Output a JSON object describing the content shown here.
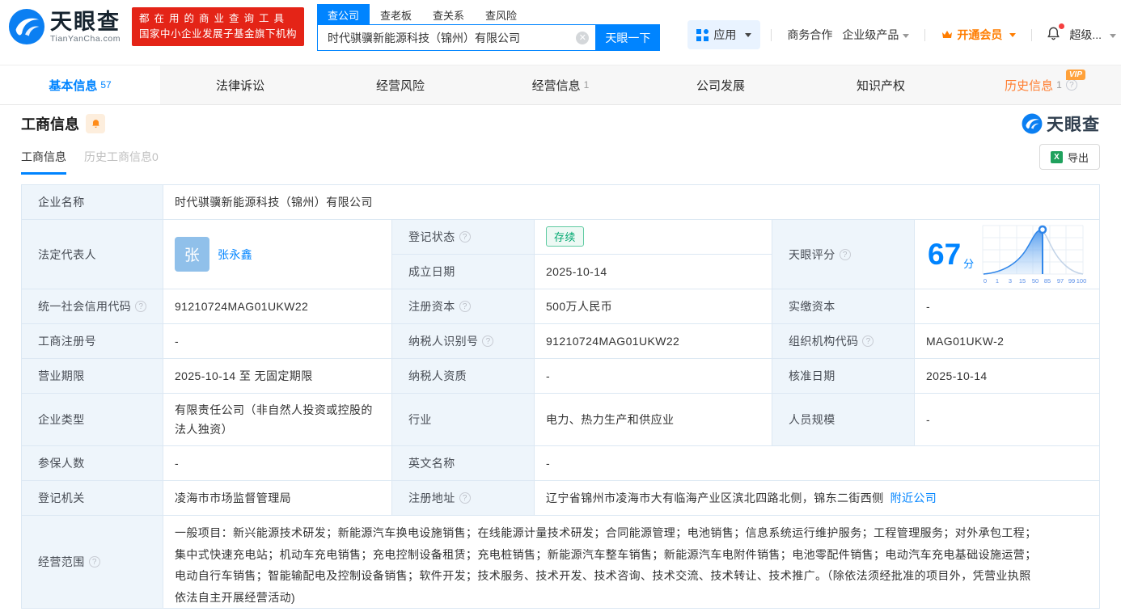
{
  "header": {
    "logo": {
      "title": "天眼查",
      "domain": "TianYanCha.com"
    },
    "slogan": {
      "line1": "都在用的商业查询工具",
      "line2": "国家中小企业发展子基金旗下机构"
    },
    "search": {
      "tabs": [
        {
          "label": "查公司"
        },
        {
          "label": "查老板"
        },
        {
          "label": "查关系"
        },
        {
          "label": "查风险"
        }
      ],
      "value": "时代骐骥新能源科技（锦州）有限公司",
      "button": "天眼一下"
    },
    "menu": {
      "apps": "应用",
      "cooperation": "商务合作",
      "enterprise": "企业级产品",
      "vip": "开通会员",
      "super": "超级..."
    }
  },
  "nav_tabs": [
    {
      "label": "基本信息",
      "count": "57"
    },
    {
      "label": "法律诉讼",
      "count": ""
    },
    {
      "label": "经营风险",
      "count": ""
    },
    {
      "label": "经营信息",
      "count": "1"
    },
    {
      "label": "公司发展",
      "count": ""
    },
    {
      "label": "知识产权",
      "count": ""
    },
    {
      "label": "历史信息",
      "count": "1",
      "vip": "VIP"
    }
  ],
  "section": {
    "title": "工商信息",
    "watermark": "天眼查",
    "subtab_active": "工商信息",
    "subtab_history": "历史工商信息0",
    "export": "导出"
  },
  "fields": {
    "name_label": "企业名称",
    "name": "时代骐骥新能源科技（锦州）有限公司",
    "legal_rep_label": "法定代表人",
    "legal_rep_avatar": "张",
    "legal_rep": "张永鑫",
    "reg_status_label": "登记状态",
    "reg_status": "存续",
    "establish_label": "成立日期",
    "establish": "2025-10-14",
    "score_label": "天眼评分",
    "score": "67",
    "score_unit": "分",
    "credit_code_label": "统一社会信用代码",
    "credit_code": "91210724MAG01UKW22",
    "reg_capital_label": "注册资本",
    "reg_capital": "500万人民币",
    "paid_capital_label": "实缴资本",
    "paid_capital": "-",
    "reg_no_label": "工商注册号",
    "reg_no": "-",
    "taxpayer_id_label": "纳税人识别号",
    "taxpayer_id": "91210724MAG01UKW22",
    "org_code_label": "组织机构代码",
    "org_code": "MAG01UKW-2",
    "term_label": "营业期限",
    "term": "2025-10-14 至 无固定期限",
    "taxpayer_quality_label": "纳税人资质",
    "taxpayer_quality": "-",
    "approval_label": "核准日期",
    "approval": "2025-10-14",
    "type_label": "企业类型",
    "type": "有限责任公司（非自然人投资或控股的法人独资）",
    "industry_label": "行业",
    "industry": "电力、热力生产和供应业",
    "staff_label": "人员规模",
    "staff": "-",
    "insured_label": "参保人数",
    "insured": "-",
    "en_name_label": "英文名称",
    "en_name": "-",
    "authority_label": "登记机关",
    "authority": "凌海市市场监督管理局",
    "address_label": "注册地址",
    "address": "辽宁省锦州市凌海市大有临海产业区滨北四路北侧，锦东二街西侧",
    "address_link": "附近公司",
    "scope_label": "经营范围",
    "scope": "一般项目：新兴能源技术研发；新能源汽车换电设施销售；在线能源计量技术研发；合同能源管理；电池销售；信息系统运行维护服务；工程管理服务；对外承包工程；集中式快速充电站；机动车充电销售；充电控制设备租赁；充电桩销售；新能源汽车整车销售；新能源汽车电附件销售；电池零配件销售；电动汽车充电基础设施运营；电动自行车销售；智能输配电及控制设备销售；软件开发；技术服务、技术开发、技术咨询、技术交流、技术转让、技术推广。（除依法须经批准的项目外，凭营业执照依法自主开展经营活动)"
  },
  "score_chart": {
    "type": "line",
    "score": 67,
    "axis": [
      "0",
      "1",
      "3",
      "15",
      "50",
      "85",
      "97",
      "99",
      "100"
    ]
  }
}
